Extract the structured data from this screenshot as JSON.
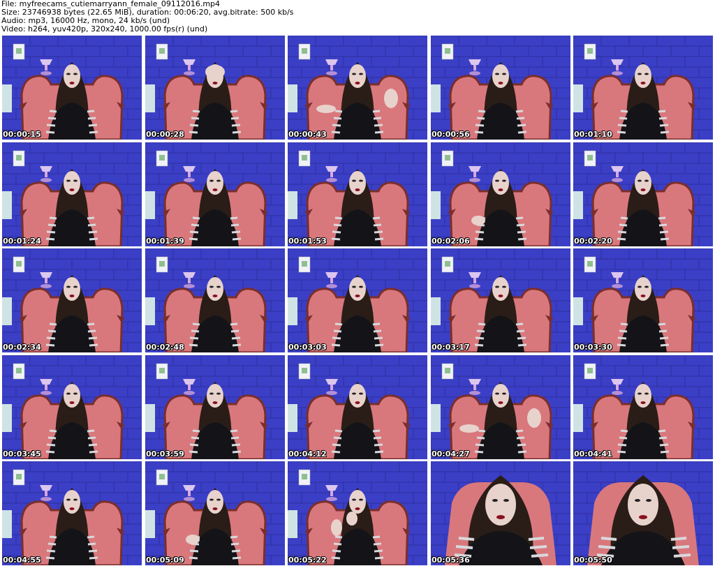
{
  "file_info": {
    "file": "File: myfreecams_cutiemarryann_female_09112016.mp4",
    "size": "Size: 23746938 bytes (22.65 MiB), duration: 00:06:20, avg.bitrate: 500 kb/s",
    "audio": "Audio: mp3, 16000 Hz, mono, 24 kb/s (und)",
    "video": "Video: h264, yuv420p, 320x240, 1000.00 fps(r) (und)"
  },
  "thumbnails": [
    {
      "time": "00:00:15",
      "variant": "normal"
    },
    {
      "time": "00:00:28",
      "variant": "hands-face"
    },
    {
      "time": "00:00:43",
      "variant": "arms-out"
    },
    {
      "time": "00:00:56",
      "variant": "normal"
    },
    {
      "time": "00:01:10",
      "variant": "normal"
    },
    {
      "time": "00:01:24",
      "variant": "normal"
    },
    {
      "time": "00:01:39",
      "variant": "normal"
    },
    {
      "time": "00:01:53",
      "variant": "normal"
    },
    {
      "time": "00:02:06",
      "variant": "hand-left"
    },
    {
      "time": "00:02:20",
      "variant": "normal"
    },
    {
      "time": "00:02:34",
      "variant": "normal"
    },
    {
      "time": "00:02:48",
      "variant": "normal"
    },
    {
      "time": "00:03:03",
      "variant": "normal"
    },
    {
      "time": "00:03:17",
      "variant": "normal"
    },
    {
      "time": "00:03:30",
      "variant": "normal"
    },
    {
      "time": "00:03:45",
      "variant": "normal"
    },
    {
      "time": "00:03:59",
      "variant": "normal"
    },
    {
      "time": "00:04:12",
      "variant": "normal"
    },
    {
      "time": "00:04:27",
      "variant": "arms-out"
    },
    {
      "time": "00:04:41",
      "variant": "normal"
    },
    {
      "time": "00:04:55",
      "variant": "normal"
    },
    {
      "time": "00:05:09",
      "variant": "hand-left"
    },
    {
      "time": "00:05:22",
      "variant": "hand-right"
    },
    {
      "time": "00:05:36",
      "variant": "closeup"
    },
    {
      "time": "00:05:50",
      "variant": "closeup"
    }
  ],
  "colors": {
    "wall": "#3b3fc6",
    "wall_dark": "#2c2f9e",
    "chair": "#d9787c",
    "chair_dark": "#7a2e2c",
    "hair": "#2a1d18",
    "skin": "#e8d2cc",
    "dress": "#141418",
    "stripe": "#d8d8dc",
    "lips": "#8a1020"
  }
}
